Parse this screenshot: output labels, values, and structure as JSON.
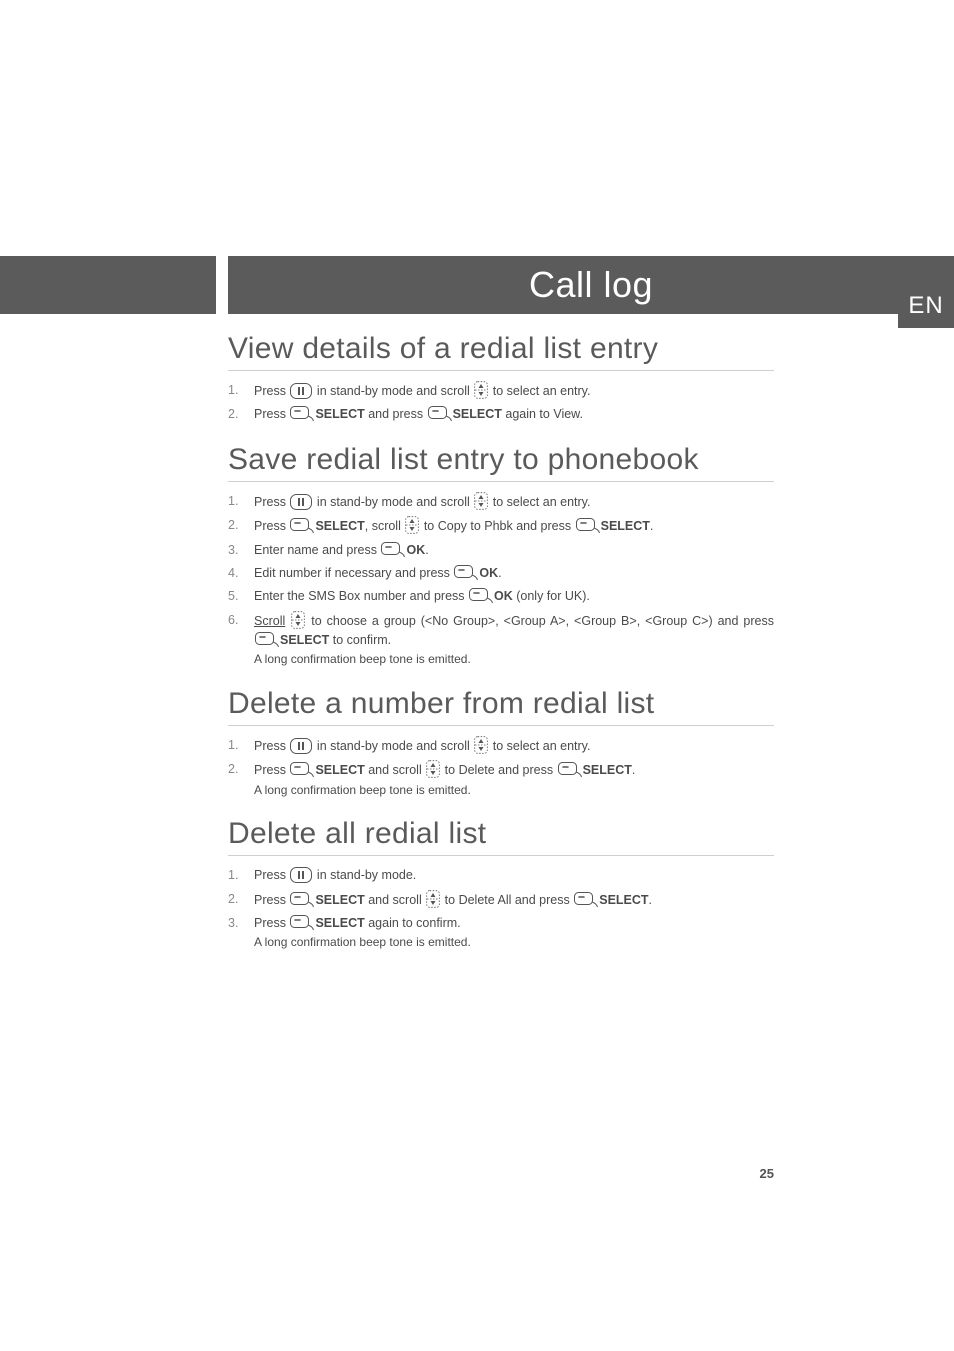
{
  "header": {
    "title": "Call log",
    "lang": "EN"
  },
  "page_number": "25",
  "sections": [
    {
      "heading": "View details of a redial list entry",
      "steps": [
        {
          "parts": [
            {
              "t": "Press "
            },
            {
              "icon": "redial"
            },
            {
              "t": " in stand-by mode and scroll "
            },
            {
              "icon": "updown"
            },
            {
              "t": " to select an entry."
            }
          ]
        },
        {
          "parts": [
            {
              "t": "Press "
            },
            {
              "icon": "softkey"
            },
            {
              "b": "SELECT"
            },
            {
              "t": " and press "
            },
            {
              "icon": "softkey"
            },
            {
              "b": "SELECT"
            },
            {
              "t": " again to View."
            }
          ]
        }
      ]
    },
    {
      "heading": "Save redial list entry to phonebook",
      "steps": [
        {
          "parts": [
            {
              "t": "Press "
            },
            {
              "icon": "redial"
            },
            {
              "t": " in stand-by mode and scroll "
            },
            {
              "icon": "updown"
            },
            {
              "t": " to select an entry."
            }
          ]
        },
        {
          "parts": [
            {
              "t": "Press "
            },
            {
              "icon": "softkey"
            },
            {
              "b": "SELECT"
            },
            {
              "t": ", scroll "
            },
            {
              "icon": "updown"
            },
            {
              "t": " to Copy to Phbk and press "
            },
            {
              "icon": "softkey"
            },
            {
              "b": "SELECT"
            },
            {
              "t": "."
            }
          ]
        },
        {
          "parts": [
            {
              "t": "Enter name and press "
            },
            {
              "icon": "softkey"
            },
            {
              "b": "OK"
            },
            {
              "t": "."
            }
          ]
        },
        {
          "parts": [
            {
              "t": "Edit number if necessary and press "
            },
            {
              "icon": "softkey"
            },
            {
              "b": "OK"
            },
            {
              "t": "."
            }
          ]
        },
        {
          "parts": [
            {
              "t": "Enter the SMS Box number and press "
            },
            {
              "icon": "softkey"
            },
            {
              "b": "OK"
            },
            {
              "t": " (only for UK)."
            }
          ]
        },
        {
          "parts": [
            {
              "u": "Scroll"
            },
            {
              "t": " "
            },
            {
              "icon": "updown"
            },
            {
              "t": " to choose a group (<No Group>, <Group A>, <Group B>, <Group C>) and press "
            },
            {
              "icon": "softkey"
            },
            {
              "b": "SELECT"
            },
            {
              "t": " to confirm."
            }
          ],
          "sub": "A long confirmation beep tone is emitted."
        }
      ]
    },
    {
      "heading": "Delete a number from redial list",
      "steps": [
        {
          "parts": [
            {
              "t": "Press "
            },
            {
              "icon": "redial"
            },
            {
              "t": " in stand-by mode and scroll "
            },
            {
              "icon": "updown"
            },
            {
              "t": " to select an entry."
            }
          ]
        },
        {
          "parts": [
            {
              "t": "Press "
            },
            {
              "icon": "softkey"
            },
            {
              "b": "SELECT"
            },
            {
              "t": " and scroll "
            },
            {
              "icon": "updown"
            },
            {
              "t": " to Delete and press "
            },
            {
              "icon": "softkey"
            },
            {
              "b": "SELECT"
            },
            {
              "t": "."
            }
          ],
          "sub": "A long confirmation beep tone is emitted."
        }
      ]
    },
    {
      "heading": "Delete all redial list",
      "steps": [
        {
          "parts": [
            {
              "t": "Press "
            },
            {
              "icon": "redial"
            },
            {
              "t": " in stand-by mode."
            }
          ]
        },
        {
          "parts": [
            {
              "t": "Press "
            },
            {
              "icon": "softkey"
            },
            {
              "b": "SELECT"
            },
            {
              "t": " and scroll "
            },
            {
              "icon": "updown"
            },
            {
              "t": " to Delete All and press "
            },
            {
              "icon": "softkey"
            },
            {
              "b": "SELECT"
            },
            {
              "t": "."
            }
          ]
        },
        {
          "parts": [
            {
              "t": "Press "
            },
            {
              "icon": "softkey"
            },
            {
              "b": "SELECT"
            },
            {
              "t": " again to confirm."
            }
          ],
          "sub": "A long confirmation beep tone is emitted."
        }
      ]
    }
  ]
}
